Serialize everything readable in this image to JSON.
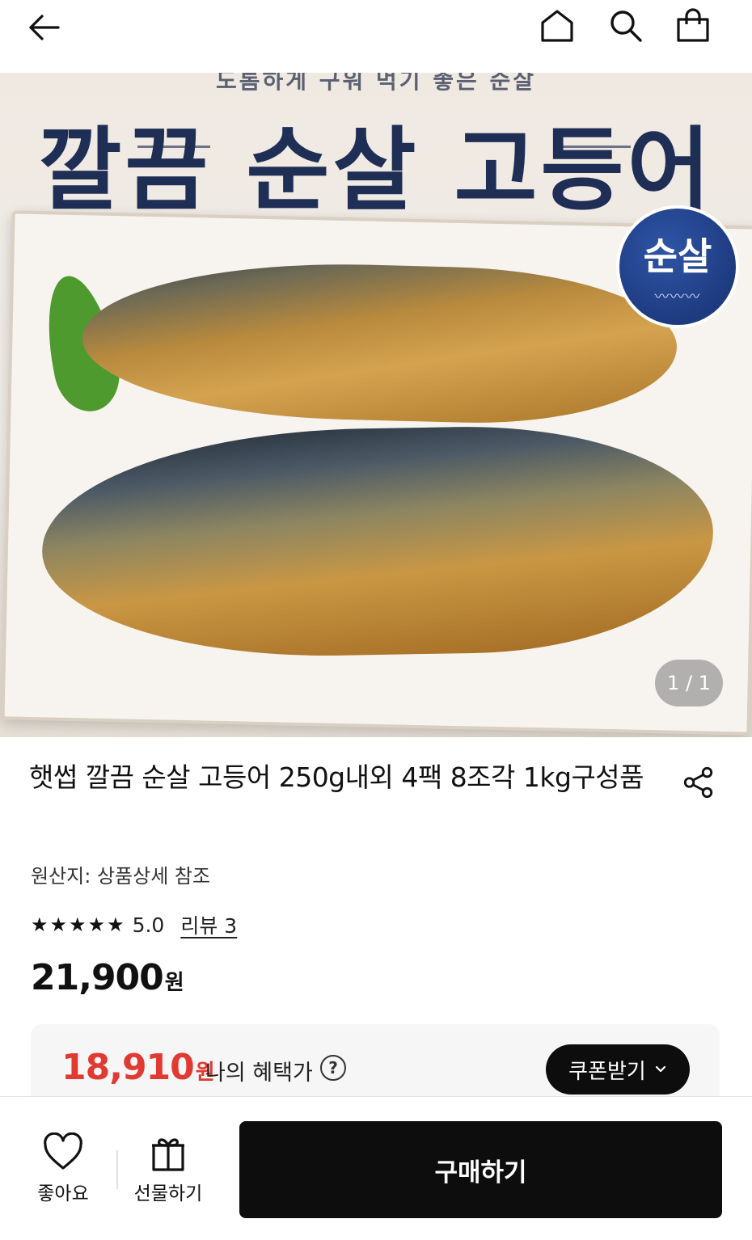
{
  "nav": {
    "back_icon": "arrow-left-icon",
    "home_icon": "home-icon",
    "search_icon": "search-icon",
    "cart_icon": "shopping-bag-icon"
  },
  "hero": {
    "subtitle": "도톰하게 구워 먹기 좋은 순살",
    "headline": "깔끔 순살 고등어",
    "badge": "순살",
    "pager": "1 / 1"
  },
  "product": {
    "title": "햇썹 깔끔 순살 고등어 250g내외 4팩 8조각 1kg구성품",
    "share_icon": "share-icon",
    "origin": "원산지: 상품상세 참조",
    "stars": "★★★★★",
    "rating": 5.0,
    "rating_text": "5.0",
    "review_link": "리뷰 3",
    "price": "21,900",
    "price_unit": "원"
  },
  "benefit": {
    "price": "18,910",
    "price_unit": "원",
    "label": "나의 혜택가",
    "help_icon": "question-circle-icon",
    "coupon_button": "쿠폰받기",
    "coupon_chevron": "chevron-down-icon",
    "accent_color": "#e03a32"
  },
  "bottom_bar": {
    "like_label": "좋아요",
    "like_icon": "heart-icon",
    "gift_label": "선물하기",
    "gift_icon": "gift-icon",
    "buy_button": "구매하기"
  }
}
